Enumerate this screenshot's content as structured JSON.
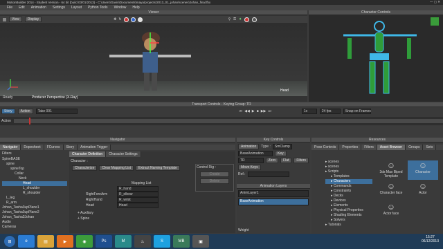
{
  "window": {
    "title": "MotionBuilder 2014 - Student Version - 64 bit (build 03/01/2013) - C:\\Users\\Gavin\\Documents\\maya\\projects\\2013_01_johan\\scenes\\Johan_final.fbx"
  },
  "menu": [
    "File",
    "Edit",
    "Animation",
    "Settings",
    "Layout",
    "Python Tools",
    "Window",
    "Help"
  ],
  "viewer": {
    "header": "Viewer",
    "view_btn": "View",
    "display_btn": "Display",
    "camera_label": "Producer Perspective (X-Ray)",
    "selected_label": "Head",
    "status": "Ready"
  },
  "character_controls": {
    "header": "Character Controls"
  },
  "transport": {
    "header": "Transport Controls - Keying Group: TR",
    "story_btn": "Story",
    "action_btn": "Action",
    "take": "Take 001",
    "speed": "1x",
    "fps": "24 fps",
    "snap": "Snap on Frames",
    "action_label": "Action"
  },
  "navigator": {
    "header": "Navigator",
    "tabs": [
      "Navigator",
      "Dopesheet",
      "FCurves",
      "Story",
      "Animation Trigger"
    ],
    "filters": "Filters",
    "tree": [
      "SpineBASE",
      "spine",
      "spineTop",
      "Collar",
      "Neck",
      "Head",
      "L_shoulder",
      "R_shoulder",
      "L_leg",
      "R_arm",
      "Johan_Tasha3upPlane1",
      "Johan_Tasha3upPlane2",
      "Johan_Tasha3Johan",
      "Audio",
      "Cameras"
    ],
    "char_tabs": [
      "Character Definition",
      "Character Settings"
    ],
    "character_label": "Character :",
    "characterize_btn": "Characterize",
    "clear_btn": "Clear Mapping List",
    "extract_btn": "Extract Naming Template",
    "mapping_list_header": "Mapping List",
    "rows": [
      {
        "name": "",
        "map": "R_hand"
      },
      {
        "name": "RightForeArm",
        "map": "R_elbow"
      },
      {
        "name": "RightHand",
        "map": "R_wrist"
      },
      {
        "name": "Head",
        "map": "Head"
      }
    ],
    "groups": [
      "Auxiliary",
      "Spine"
    ],
    "control_rig_label": "Control Rig :",
    "create_btn": "Create",
    "delete_btn": "Delete"
  },
  "key_controls": {
    "header": "Key Controls",
    "animation_btn": "Animation",
    "type_label": "Type :",
    "type_value": "SmClamp",
    "layer": "BaseAnimation",
    "key_btn": "Key",
    "tr_value": "TR",
    "zero_btn": "Zero",
    "flat_btn": "Flat",
    "filters_btn": "Filters",
    "move_keys_btn": "Move Keys",
    "ref_label": "Ref.:",
    "anim_layers_header": "Animation Layers",
    "layers": [
      "AnimLayer1",
      "BaseAnimation"
    ],
    "weight_label": "Weight"
  },
  "resources": {
    "header": "Resources",
    "tabs": [
      "Pose Controls",
      "Properties",
      "Filters",
      "Asset Browser",
      "Groups",
      "Sets"
    ],
    "tree": [
      "scenes",
      "scenes",
      "Scripts",
      "Templates",
      "Characters",
      "Commands",
      "Constraints",
      "Decks",
      "Devices",
      "Elements",
      "Physical Properties",
      "Shading Elements",
      "Solvers",
      "Tutorials"
    ],
    "assets": [
      "3ds Max Biped Template",
      "Character",
      "Character face",
      "Actor",
      "Actor face"
    ]
  },
  "taskbar": {
    "time": "15:27",
    "date": "06/12/2013"
  }
}
